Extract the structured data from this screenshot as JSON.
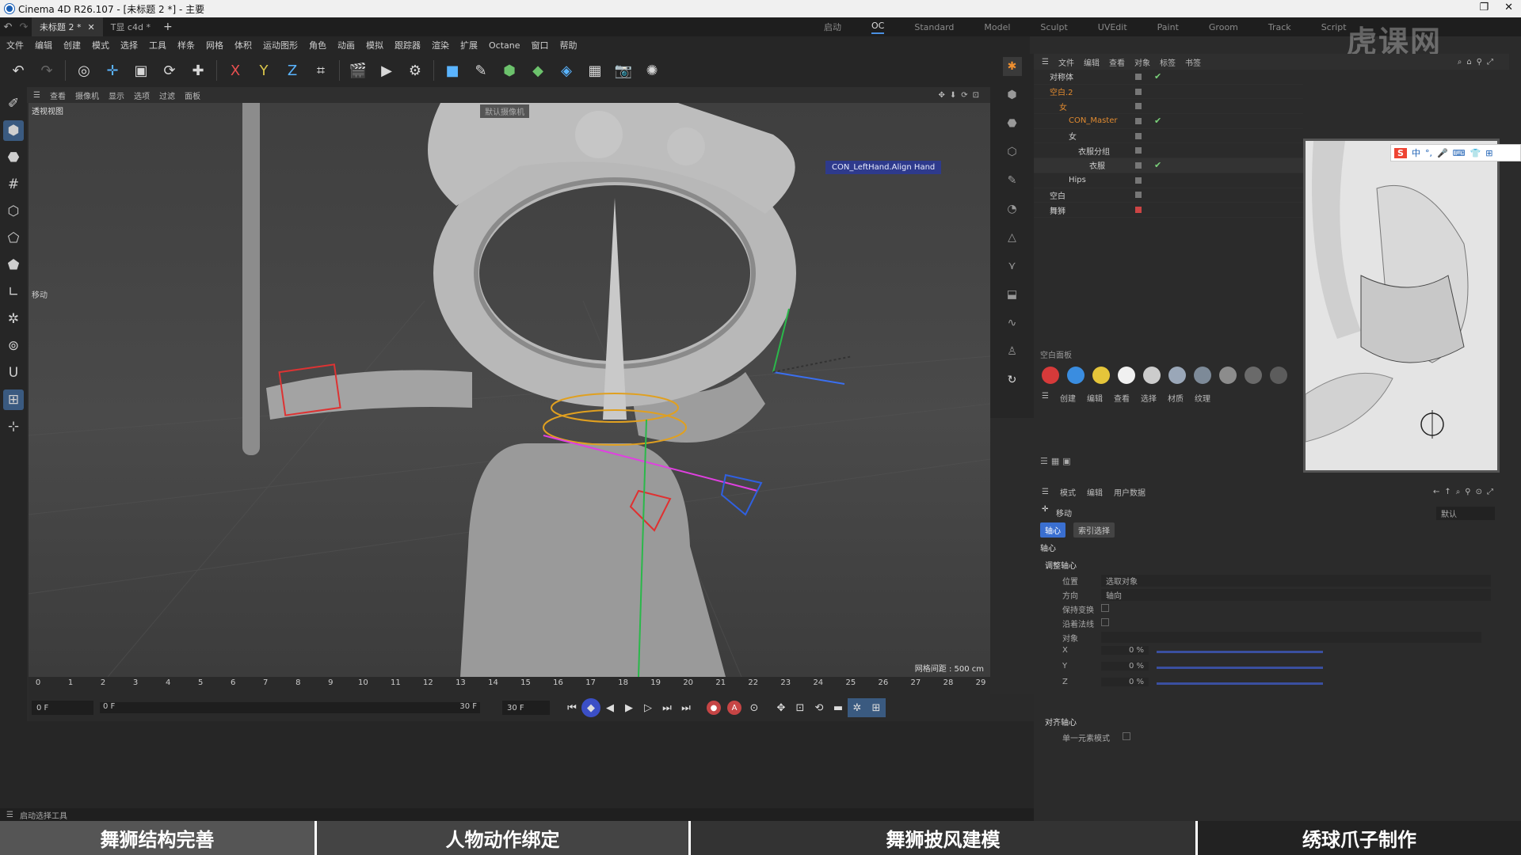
{
  "title_bar": {
    "text": "Cinema 4D R26.107 - [未标题 2 *] - 主要",
    "buttons": [
      "❐",
      "✕"
    ]
  },
  "doc_tabs": [
    {
      "label": "未标题 2 *"
    },
    {
      "label": "T显 c4d *"
    }
  ],
  "add_tab": "+",
  "layout_tabs": [
    "启动",
    "OC",
    "Standard",
    "Model",
    "Sculpt",
    "UVEdit",
    "Paint",
    "Groom",
    "Track",
    "Script"
  ],
  "active_layout": "OC",
  "menu": [
    "文件",
    "编辑",
    "创建",
    "模式",
    "选择",
    "工具",
    "样条",
    "网格",
    "体积",
    "运动图形",
    "角色",
    "动画",
    "模拟",
    "跟踪器",
    "渲染",
    "扩展",
    "Octane",
    "窗口",
    "帮助"
  ],
  "viewport_menu": [
    "查看",
    "摄像机",
    "显示",
    "选项",
    "过滤",
    "面板"
  ],
  "viewport": {
    "label": "透视视图",
    "camera": "默认摄像机",
    "hud_label": "CON_LeftHand.Align Hand",
    "grid_label": "网格间距 : 500 cm",
    "move_label": "移动"
  },
  "timeline": {
    "ticks": [
      "0",
      "1",
      "2",
      "3",
      "4",
      "5",
      "6",
      "7",
      "8",
      "9",
      "10",
      "11",
      "12",
      "13",
      "14",
      "15",
      "16",
      "17",
      "18",
      "19",
      "20",
      "21",
      "22",
      "23",
      "24",
      "25",
      "26",
      "27",
      "28",
      "29"
    ],
    "current_frame": "0 F",
    "range_start": "0 F",
    "range_end": "30 F",
    "end_frame": "30 F"
  },
  "status": "启动选择工具",
  "object_manager": {
    "menu": [
      "文件",
      "编辑",
      "查看",
      "对象",
      "标签",
      "书签"
    ],
    "rows": [
      {
        "name": "对称体",
        "indent": 0
      },
      {
        "name": "空白.2",
        "indent": 0
      },
      {
        "name": "女",
        "indent": 1
      },
      {
        "name": "CON_Master",
        "indent": 2
      },
      {
        "name": "女",
        "indent": 2
      },
      {
        "name": "衣服分组",
        "indent": 3
      },
      {
        "name": "衣服",
        "indent": 4
      },
      {
        "name": "Hips",
        "indent": 2
      },
      {
        "name": "空白",
        "indent": 0
      },
      {
        "name": "舞狮",
        "indent": 0
      }
    ]
  },
  "ime_bar": {
    "logo": "S",
    "mode": "中"
  },
  "material_manager": {
    "title": "空白面板",
    "menu": [
      "创建",
      "编辑",
      "查看",
      "选择",
      "材质",
      "纹理"
    ],
    "colors": [
      "#d63a3a",
      "#3a8de0",
      "#e5c53a",
      "#f0f0f0",
      "#cccccc",
      "#9aa7b8",
      "#7d8a98",
      "#8c8c8c",
      "#6a6a6a",
      "#5c5c5c"
    ]
  },
  "attributes": {
    "menu": [
      "模式",
      "编辑",
      "用户数据"
    ],
    "title": "移动",
    "dropdown": "默认",
    "tab_active": "轴心",
    "tab_other": "索引选择",
    "section": "轴心",
    "subsection1": "调整轴心",
    "fields": [
      {
        "label": "位置",
        "value": "选取对象"
      },
      {
        "label": "方向",
        "value": "轴向"
      },
      {
        "label": "保持变换",
        "value": ""
      },
      {
        "label": "沿着法线",
        "value": ""
      },
      {
        "label": "对象",
        "value": ""
      }
    ],
    "xyz": [
      {
        "axis": "X",
        "value": "0 %"
      },
      {
        "axis": "Y",
        "value": "0 %"
      },
      {
        "axis": "Z",
        "value": "0 %"
      }
    ],
    "subsection2": "对齐轴心",
    "checkbox_label": "单一元素模式"
  },
  "watermark": "虎课网",
  "banner": [
    "舞狮结构完善",
    "人物动作绑定",
    "舞狮披风建模",
    "绣球爪子制作"
  ]
}
